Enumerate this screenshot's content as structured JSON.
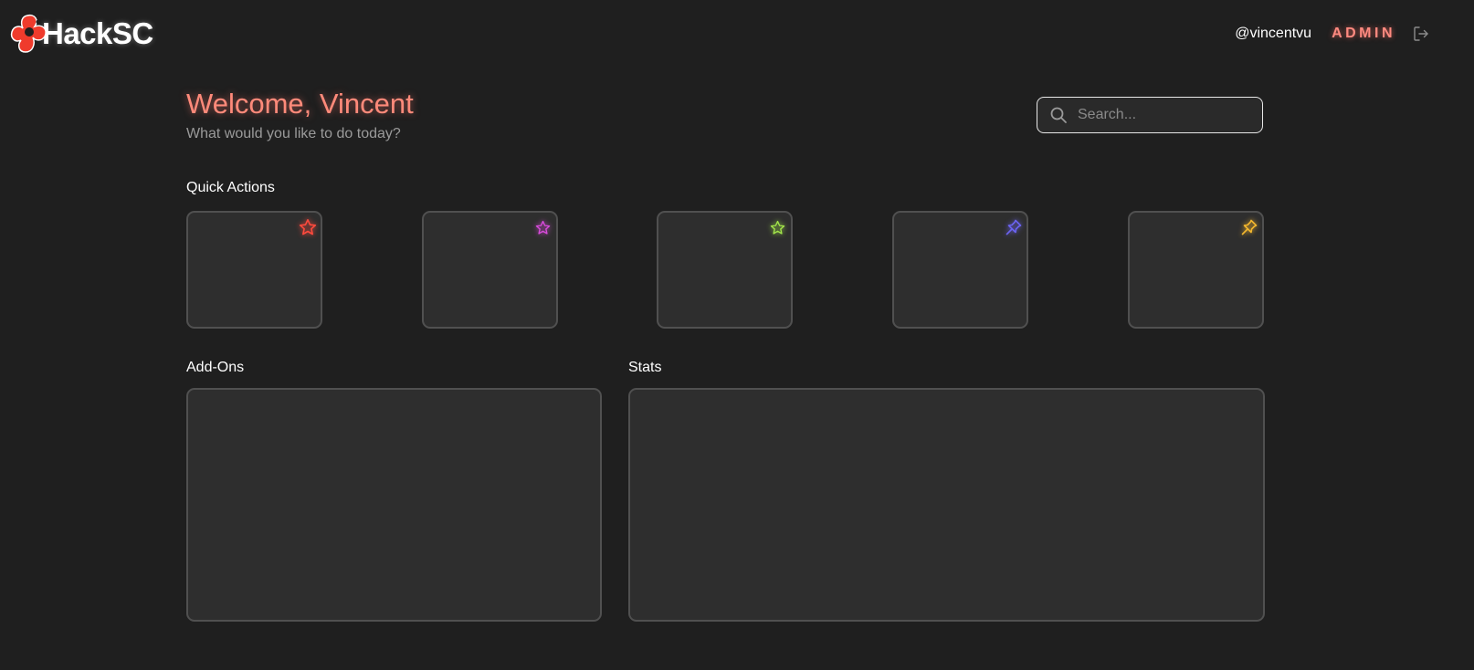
{
  "header": {
    "logo_text": "HackSC",
    "username": "@vincentvu",
    "role_badge": "ADMIN",
    "brand_color": "#ef3b2c"
  },
  "welcome": {
    "title": "Welcome, Vincent",
    "subtitle": "What would you like to do today?"
  },
  "search": {
    "placeholder": "Search..."
  },
  "quick_actions": {
    "title": "Quick Actions",
    "items": [
      {
        "icon": "star-icon",
        "color": "#ff4a3d"
      },
      {
        "icon": "star-icon",
        "color": "#d94bdc"
      },
      {
        "icon": "star-icon",
        "color": "#a3e64a"
      },
      {
        "icon": "pin-icon",
        "color": "#6b63f0"
      },
      {
        "icon": "pin-icon",
        "color": "#f3b72e"
      }
    ]
  },
  "addons": {
    "title": "Add-Ons"
  },
  "stats": {
    "title": "Stats"
  }
}
